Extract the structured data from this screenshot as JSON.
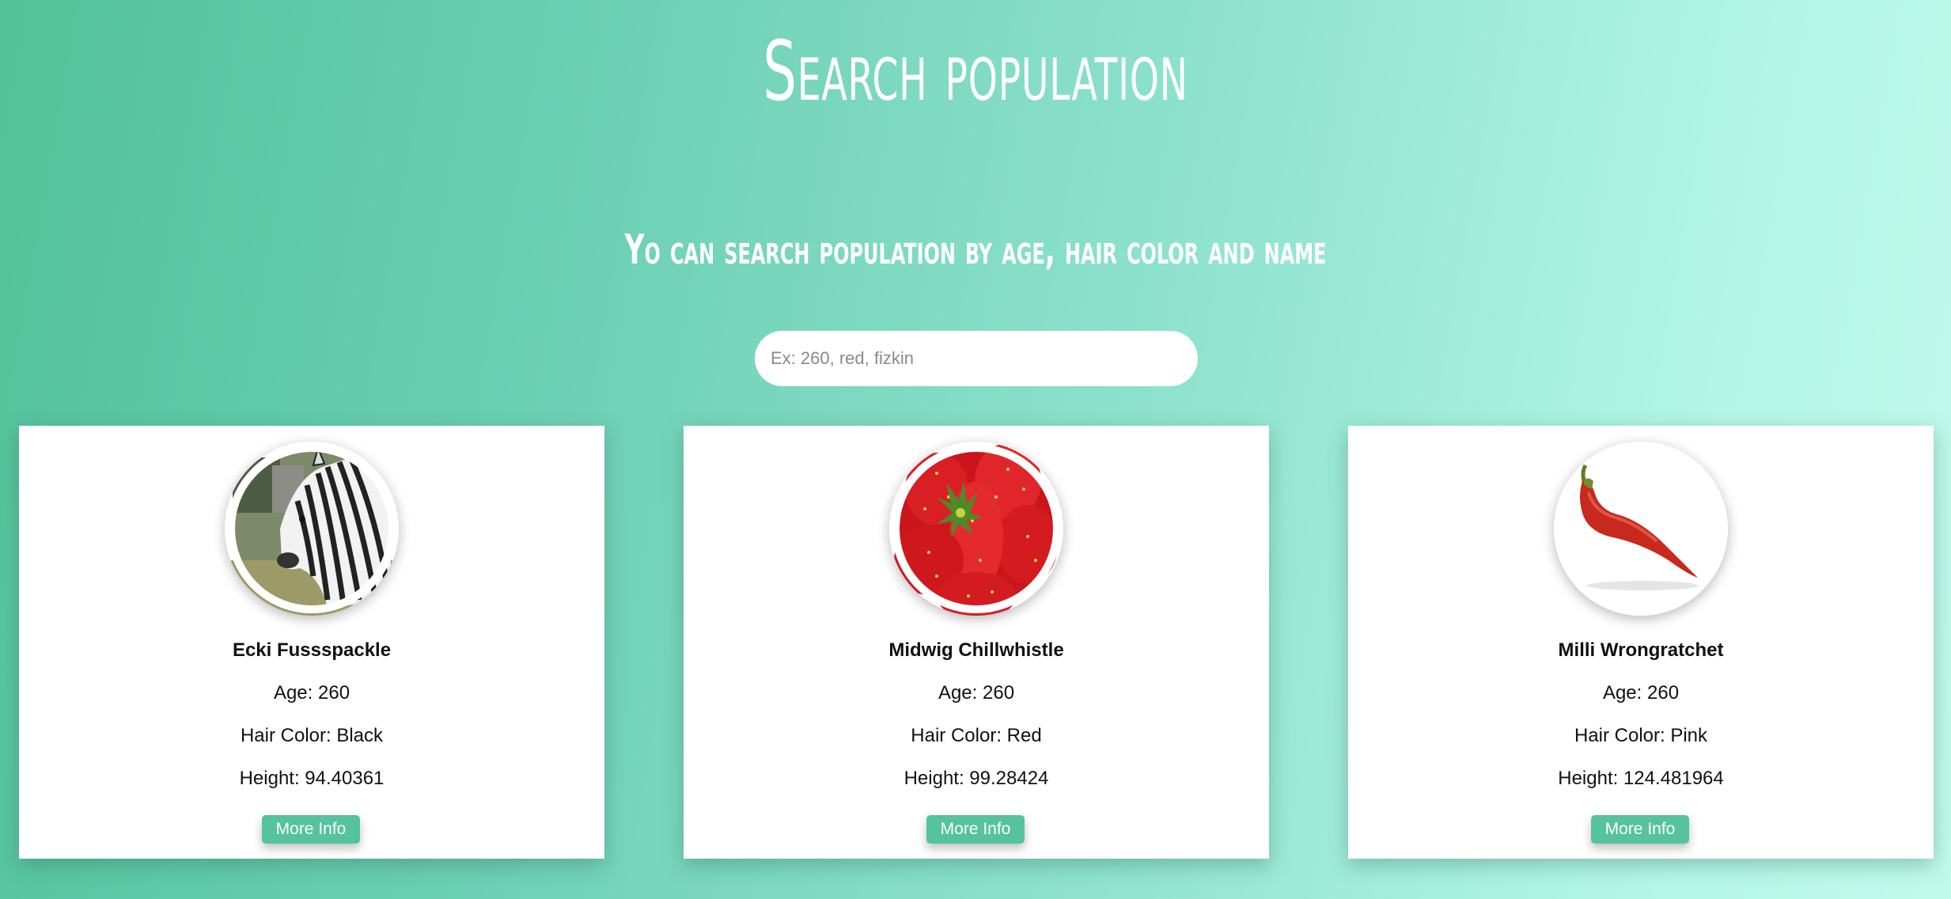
{
  "header": {
    "title": "Search population",
    "subtitle": "Yo can search population by age, hair color and name"
  },
  "search": {
    "placeholder": "Ex: 260, red, fizkin",
    "value": ""
  },
  "cards": [
    {
      "name": "Ecki Fussspackle",
      "age": "Age: 260",
      "hair_color": "Hair Color: Black",
      "height": "Height: 94.40361",
      "button_label": "More Info",
      "image": "zebra-photo"
    },
    {
      "name": "Midwig Chillwhistle",
      "age": "Age: 260",
      "hair_color": "Hair Color: Red",
      "height": "Height: 99.28424",
      "button_label": "More Info",
      "image": "strawberries-photo"
    },
    {
      "name": "Milli Wrongratchet",
      "age": "Age: 260",
      "hair_color": "Hair Color: Pink",
      "height": "Height: 124.481964",
      "button_label": "More Info",
      "image": "chili-pepper-photo"
    }
  ],
  "colors": {
    "accent": "#55c39d",
    "background_start": "#52c29a",
    "background_end": "#c0faeb"
  }
}
